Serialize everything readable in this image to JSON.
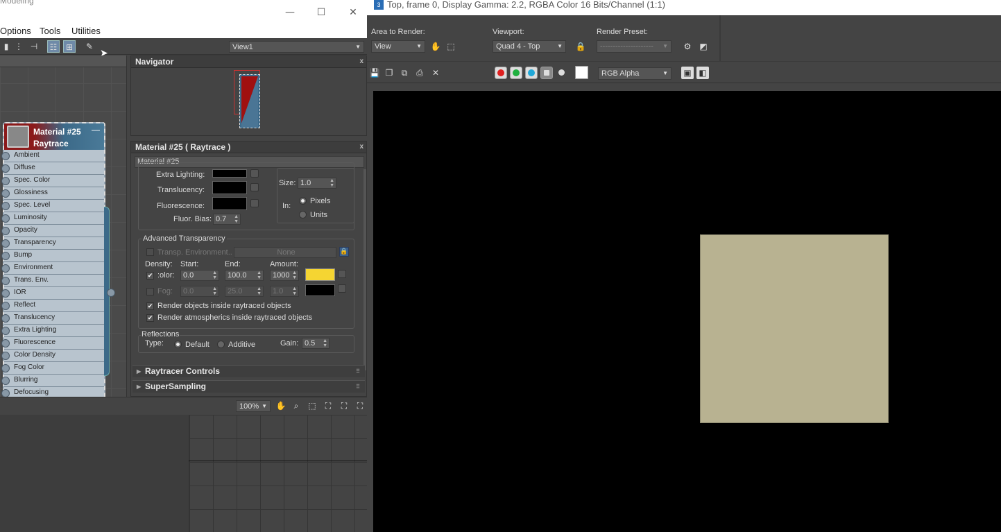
{
  "slate": {
    "title_ghost": "Modeling",
    "window_buttons": {
      "minimize": "—",
      "maximize": "☐",
      "close": "✕"
    },
    "menu": [
      "Options",
      "Tools",
      "Utilities"
    ],
    "view_dropdown": "View1",
    "node": {
      "name_line1": "Material #25",
      "name_line2": "Raytrace",
      "minimize_glyph": "—",
      "slots": [
        "Ambient",
        "Diffuse",
        "Spec. Color",
        "Glossiness",
        "Spec. Level",
        "Luminosity",
        "Opacity",
        "Transparency",
        "Bump",
        "Environment",
        "Trans. Env.",
        "IOR",
        "Reflect",
        "Translucency",
        "Extra Lighting",
        "Fluorescence",
        "Color Density",
        "Fog Color",
        "Blurring",
        "Defocusing"
      ]
    },
    "navigator": {
      "title": "Navigator",
      "close": "x"
    },
    "material_panel": {
      "title": "Material #25  ( Raytrace )",
      "close": "x",
      "name_field": "Material #25",
      "extra_lighting": "Extra Lighting:",
      "translucency": "Translucency:",
      "fluorescence": "Fluorescence:",
      "fluor_bias_label": "Fluor. Bias:",
      "fluor_bias_value": "0.7",
      "size_label": "Size:",
      "size_value": "1.0",
      "in_label": "In:",
      "pixels": "Pixels",
      "units": "Units",
      "adv_transparency": "Advanced Transparency",
      "transp_env": "Transp. Environment..",
      "none_btn": "None",
      "density": "Density:",
      "start": "Start:",
      "end": "End:",
      "amount": "Amount:",
      "color_label": ":olor:",
      "color_start": "0.0",
      "color_end": "100.0",
      "color_amount": "1000",
      "fog_label": "Fog:",
      "fog_start": "0.0",
      "fog_end": "25.0",
      "fog_amount": "1.0",
      "color_swatch": "#f5d532",
      "render_objects": "Render objects inside raytraced objects",
      "render_atmos": "Render atmospherics inside raytraced objects",
      "reflections": "Reflections",
      "type_label": "Type:",
      "default": "Default",
      "additive": "Additive",
      "gain_label": "Gain:",
      "gain_value": "0.5",
      "rollouts": [
        "Raytracer Controls",
        "SuperSampling"
      ]
    },
    "zoom": "100%"
  },
  "render": {
    "title": "Top, frame 0, Display Gamma: 2.2, RGBA Color 16 Bits/Channel (1:1)",
    "app_icon": "3",
    "area_to_render_label": "Area to Render:",
    "area_to_render_value": "View",
    "viewport_label": "Viewport:",
    "viewport_value": "Quad 4 - Top",
    "render_preset_label": "Render Preset:",
    "render_preset_value": "---------------------",
    "channel_dropdown": "RGB Alpha",
    "channel_colors": {
      "red": "#e02020",
      "green": "#20b040",
      "blue": "#20a8d8"
    },
    "rendered_square_color": "#b8b291"
  }
}
